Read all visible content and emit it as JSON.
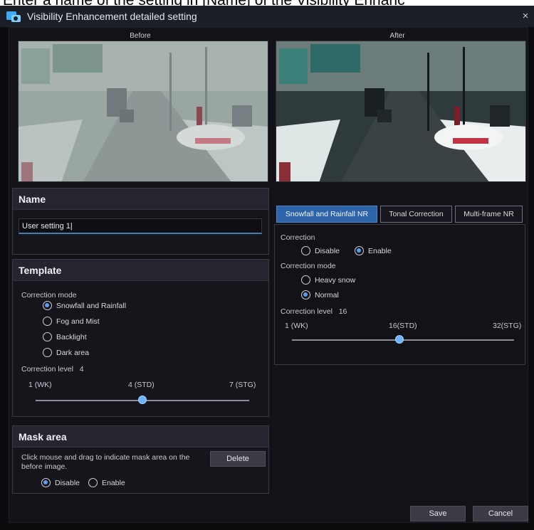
{
  "cut_heading": "Enter a name of the setting in [Name] of the Visibility Enhanc",
  "window": {
    "title": "Visibility Enhancement detailed setting",
    "close_glyph": "×"
  },
  "preview": {
    "before_label": "Before",
    "after_label": "After"
  },
  "name_panel": {
    "heading": "Name",
    "value": "User setting 1|"
  },
  "template_panel": {
    "heading": "Template",
    "correction_mode_label": "Correction mode",
    "modes": [
      {
        "label": "Snowfall and Rainfall",
        "selected": true
      },
      {
        "label": "Fog and Mist",
        "selected": false
      },
      {
        "label": "Backlight",
        "selected": false
      },
      {
        "label": "Dark area",
        "selected": false
      }
    ],
    "correction_level_label": "Correction level",
    "correction_level_value": "4",
    "scale": {
      "min_label": "1 (WK)",
      "mid_label": "4 (STD)",
      "max_label": "7 (STG)"
    },
    "level": 4,
    "level_min": 1,
    "level_max": 7
  },
  "mask_panel": {
    "heading": "Mask area",
    "instructions": "Click mouse and drag to indicate mask area on the before image.",
    "delete_label": "Delete",
    "options": [
      {
        "label": "Disable",
        "selected": true
      },
      {
        "label": "Enable",
        "selected": false
      }
    ]
  },
  "tabs": [
    {
      "label": "Snowfall and Rainfall NR",
      "active": true
    },
    {
      "label": "Tonal Correction",
      "active": false
    },
    {
      "label": "Multi-frame NR",
      "active": false
    }
  ],
  "nr_panel": {
    "correction_label": "Correction",
    "correction_options": [
      {
        "label": "Disable",
        "selected": false
      },
      {
        "label": "Enable",
        "selected": true
      }
    ],
    "correction_mode_label": "Correction mode",
    "mode_options": [
      {
        "label": "Heavy snow",
        "selected": false
      },
      {
        "label": "Normal",
        "selected": true
      }
    ],
    "correction_level_label": "Correction level",
    "correction_level_value": "16",
    "scale": {
      "min_label": "1 (WK)",
      "mid_label": "16(STD)",
      "max_label": "32(STG)"
    },
    "level": 16,
    "level_min": 1,
    "level_max": 32
  },
  "footer": {
    "save_label": "Save",
    "cancel_label": "Cancel"
  },
  "colors": {
    "accent": "#2d63a8",
    "radio_dot": "#5c9ff0",
    "slider_thumb": "#6fb3ff",
    "window_bg": "#0c0c0e"
  }
}
